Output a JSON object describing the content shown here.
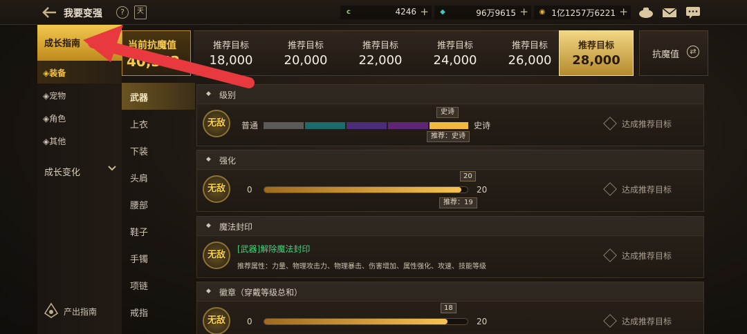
{
  "topbar": {
    "title": "我要变强",
    "help_icon": "question-icon",
    "book_icon": "calendar-icon",
    "currencies": [
      {
        "icon": "c",
        "value": "4246",
        "color": "#8fd06b"
      },
      {
        "icon": "◆",
        "value": "96万9615",
        "color": "#3fc7c0"
      },
      {
        "icon": "◉",
        "value": "1亿1257万6221",
        "color": "#e0b33a"
      }
    ],
    "icons": [
      "bag-icon",
      "mail-icon",
      "chat-icon"
    ]
  },
  "sidebar": {
    "guide_tab": "成长指南",
    "items": [
      {
        "label": "◈装备",
        "active": true
      },
      {
        "label": "◈宠物",
        "active": false
      },
      {
        "label": "◈角色",
        "active": false
      },
      {
        "label": "◈其他",
        "active": false
      }
    ],
    "growth": "成长变化",
    "output": "产出指南"
  },
  "categories": [
    "武器",
    "上衣",
    "下装",
    "头肩",
    "腰部",
    "鞋子",
    "手镯",
    "项链",
    "戒指"
  ],
  "targets": {
    "current_label": "当前抗魔值",
    "current_value": "40,352",
    "items": [
      {
        "label": "推荐目标",
        "value": "18,000"
      },
      {
        "label": "推荐目标",
        "value": "20,000"
      },
      {
        "label": "推荐目标",
        "value": "22,000"
      },
      {
        "label": "推荐目标",
        "value": "24,000"
      },
      {
        "label": "推荐目标",
        "value": "26,000"
      },
      {
        "label": "推荐目标",
        "value": "28,000"
      }
    ],
    "resist_label": "抗魔值"
  },
  "panels": {
    "level": {
      "title": "级别",
      "badge": "无敌",
      "from": "普通",
      "to": "史诗",
      "current_tag": "史诗",
      "recommend": "推荐：史诗",
      "action": "达成推荐目标",
      "rank_colors": [
        "#5a5a5a",
        "#1d6a6b",
        "#4a2c78",
        "#5e2574",
        "#f1b93d"
      ]
    },
    "enhance": {
      "title": "强化",
      "badge": "无敌",
      "min": "0",
      "max": "20",
      "current": "20",
      "fill": 0.97,
      "recommend": "推荐：19",
      "action": "达成推荐目标"
    },
    "seal": {
      "title": "魔法封印",
      "badge": "无敌",
      "name": "[武器]解除魔法封印",
      "attrs": "推荐属性：力量、物理攻击力、物理暴击、伤害增加、属性强化、攻速、技能等级",
      "action": "达成推荐目标"
    },
    "emblem": {
      "title": "徽章（穿戴等级总和）",
      "badge": "无敌",
      "min": "0",
      "max": "20",
      "current": "18",
      "fill": 0.9,
      "action": "达成推荐目标"
    }
  }
}
